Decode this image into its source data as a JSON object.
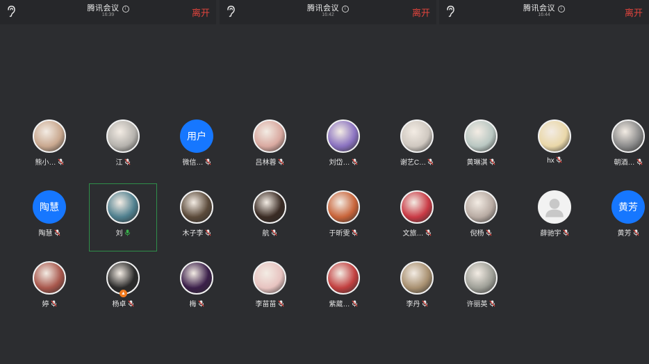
{
  "colors": {
    "background": "#2c2d30",
    "topbar": "#26272a",
    "leave": "#e2443d",
    "text_avatar": "#1677ff",
    "active_mic": "#38b24a",
    "active_frame": "#2f8f4a"
  },
  "panels": [
    {
      "title": "腾讯会议",
      "time": "16:39",
      "leave_label": "离开",
      "participants": [
        {
          "name": "熊小…",
          "avatar": "photo",
          "color": "#c9a88f",
          "mic": "muted"
        },
        {
          "name": "江",
          "avatar": "photo",
          "color": "#b5b2ad",
          "mic": "muted"
        },
        {
          "name": "微信…",
          "avatar": "text",
          "avatar_text": "用户",
          "mic": "muted"
        },
        {
          "name": "陶慧",
          "avatar": "text",
          "avatar_text": "陶慧",
          "mic": "muted"
        },
        {
          "name": "刘",
          "avatar": "photo",
          "color": "#4f7f8e",
          "mic": "active",
          "active": true
        },
        {
          "name": "木子李",
          "avatar": "photo",
          "color": "#5b4a3a",
          "mic": "muted"
        },
        {
          "name": "婷",
          "avatar": "photo",
          "color": "#a8574c",
          "mic": "muted"
        },
        {
          "name": "杨卓",
          "avatar": "photo",
          "color": "#2a2a2a",
          "mic": "muted",
          "badge": "host-badge-icon"
        },
        {
          "name": "梅",
          "avatar": "photo",
          "color": "#3b1f4a",
          "mic": "muted"
        }
      ]
    },
    {
      "title": "腾讯会议",
      "time": "16:42",
      "leave_label": "离开",
      "participants": [
        {
          "name": "吕林蓉",
          "avatar": "photo",
          "color": "#d9a9a0",
          "mic": "muted"
        },
        {
          "name": "刘岱…",
          "avatar": "photo",
          "color": "#8a72c0",
          "mic": "muted"
        },
        {
          "name": "谢艺C…",
          "avatar": "photo",
          "color": "#cfc8c0",
          "mic": "muted"
        },
        {
          "name": "航",
          "avatar": "photo",
          "color": "#3a2b24",
          "mic": "muted"
        },
        {
          "name": "于昕雯",
          "avatar": "photo",
          "color": "#c8643a",
          "mic": "muted"
        },
        {
          "name": "文旅…",
          "avatar": "photo",
          "color": "#c93a45",
          "mic": "muted"
        },
        {
          "name": "李苗苗",
          "avatar": "photo",
          "color": "#e7c3c0",
          "mic": "muted"
        },
        {
          "name": "紫葳…",
          "avatar": "photo",
          "color": "#c24040",
          "mic": "muted"
        },
        {
          "name": "李丹",
          "avatar": "photo",
          "color": "#a89070",
          "mic": "muted"
        }
      ]
    },
    {
      "title": "腾讯会议",
      "time": "16:44",
      "leave_label": "离开",
      "participants": [
        {
          "name": "黄琳淇",
          "avatar": "photo",
          "color": "#b9c7c2",
          "mic": "muted"
        },
        {
          "name": "hx",
          "avatar": "photo",
          "color": "#e9d7a8",
          "mic": "muted"
        },
        {
          "name": "朝酒…",
          "avatar": "photo",
          "color": "#8a8a8a",
          "mic": "muted"
        },
        {
          "name": "倪杨",
          "avatar": "photo",
          "color": "#b8aba3",
          "mic": "muted"
        },
        {
          "name": "薛驰宇",
          "avatar": "default",
          "mic": "muted"
        },
        {
          "name": "黄芳",
          "avatar": "text",
          "avatar_text": "黄芳",
          "mic": "muted"
        },
        {
          "name": "许丽英",
          "avatar": "photo",
          "color": "#9e9f97",
          "mic": "muted"
        }
      ]
    }
  ]
}
